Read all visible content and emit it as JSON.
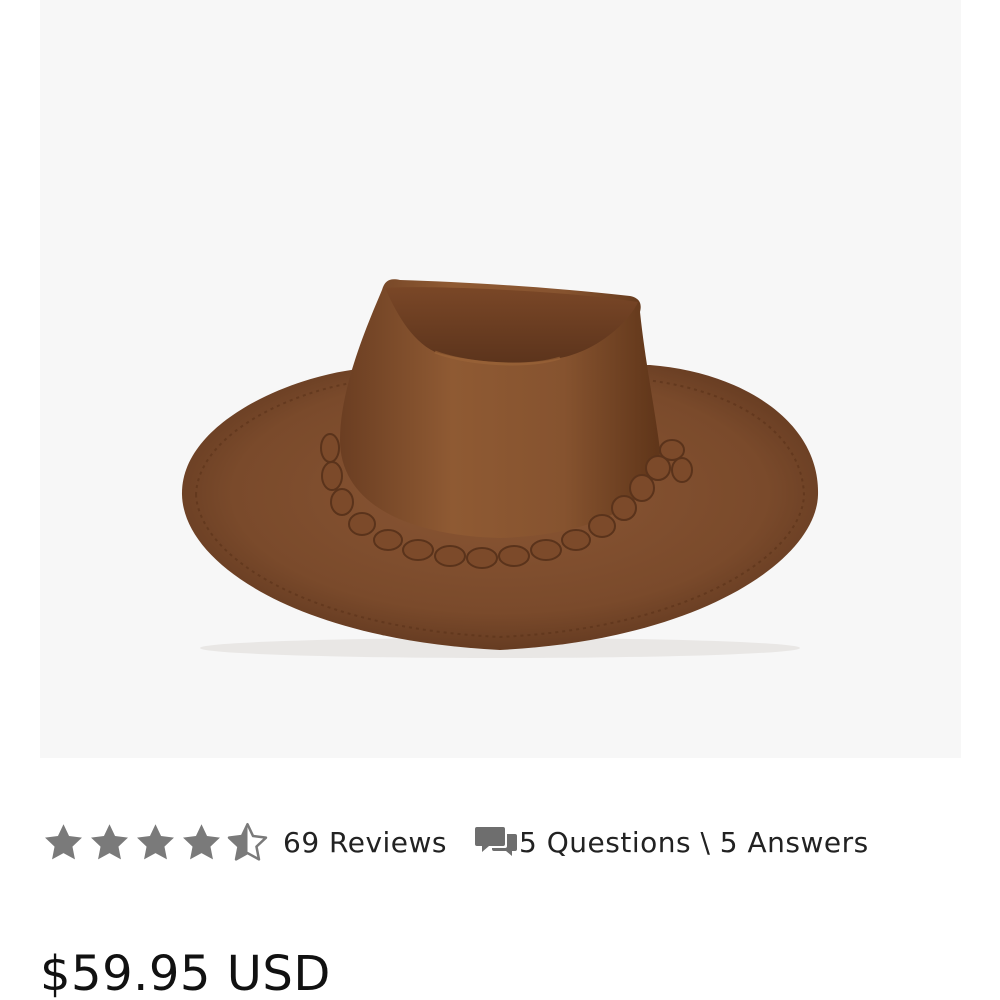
{
  "product": {
    "image_icon": "leather-cowboy-hat",
    "rating": {
      "value": 4.5,
      "max": 5,
      "star_color": "#7a7a7a"
    },
    "reviews_label": "69 Reviews",
    "qa_icon": "chat-bubbles-icon",
    "qa_label": "5 Questions \\ 5 Answers",
    "price": "$59.95 USD"
  },
  "colors": {
    "image_background": "#f7f7f7",
    "text": "#222222",
    "icon": "#6e6e6e"
  }
}
